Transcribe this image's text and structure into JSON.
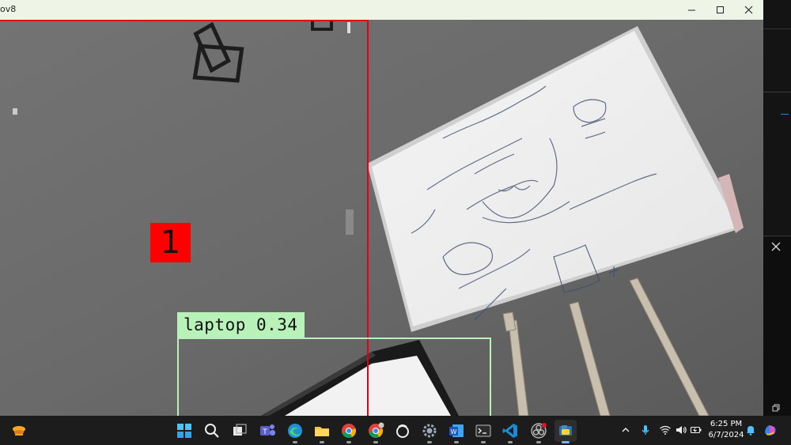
{
  "window": {
    "title": "ov8",
    "controls": [
      "minimize",
      "maximize",
      "close"
    ]
  },
  "overlay": {
    "zone_count": "1",
    "zone_color": "#ff0000",
    "detection_label": "laptop 0.34",
    "detection_color": "#b9f2b9"
  },
  "taskbar": {
    "pinned": [
      {
        "name": "start-icon"
      },
      {
        "name": "search-icon"
      },
      {
        "name": "task-view-icon"
      },
      {
        "name": "teams-icon"
      },
      {
        "name": "edge-icon"
      },
      {
        "name": "file-explorer-icon"
      },
      {
        "name": "chrome-icon"
      },
      {
        "name": "chrome-profile-icon"
      },
      {
        "name": "app-ring-icon"
      },
      {
        "name": "settings-icon"
      },
      {
        "name": "word-icon"
      },
      {
        "name": "terminal-icon"
      },
      {
        "name": "vscode-icon"
      },
      {
        "name": "obs-icon"
      },
      {
        "name": "python-icon"
      }
    ],
    "clock": {
      "time": "6:25 PM",
      "date": "6/7/2024"
    }
  }
}
